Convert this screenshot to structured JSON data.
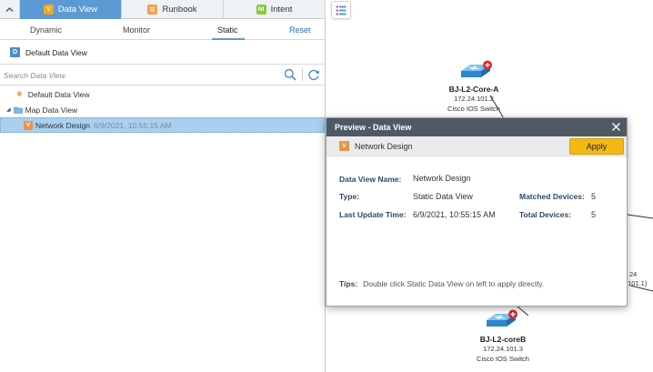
{
  "tabs": [
    {
      "label": "Data View",
      "icon_letter": "V",
      "icon_color": "#f0a91c",
      "active": true
    },
    {
      "label": "Runbook",
      "icon_letter": "",
      "icon_color": "#f0a054",
      "active": false
    },
    {
      "label": "Intent",
      "icon_letter": "NI",
      "icon_color": "#8dc63f",
      "active": false
    }
  ],
  "subtabs": {
    "dynamic": "Dynamic",
    "monitor": "Monitor",
    "static": "Static",
    "reset": "Reset"
  },
  "current_view": {
    "icon_letter": "D",
    "label": "Default Data View"
  },
  "search": {
    "placeholder": "Search Data View"
  },
  "tree": {
    "default_item": "Default Data View",
    "map_folder": "Map Data View",
    "selected_item": {
      "name": "Network Design",
      "timestamp": "6/9/2021, 10:55:15 AM"
    }
  },
  "map": {
    "nodes": [
      {
        "name": "BJ-L2-Core-A",
        "ip": "172.24.101.2",
        "type": "Cisco IOS Switch"
      },
      {
        "name": "BJ-L2-coreB",
        "ip": "172.24.101.3",
        "type": "Cisco IOS Switch"
      }
    ],
    "partial_label_1": "24",
    "partial_label_2": ".101.1)"
  },
  "preview": {
    "title": "Preview - Data View",
    "view_name": "Network Design",
    "apply_label": "Apply",
    "fields": {
      "name_label": "Data View Name:",
      "name_value": "Network Design",
      "type_label": "Type:",
      "type_value": "Static Data View",
      "update_label": "Last Update Time:",
      "update_value": "6/9/2021, 10:55:15 AM",
      "matched_label": "Matched Devices:",
      "matched_value": "5",
      "total_label": "Total Devices:",
      "total_value": "5"
    },
    "tips_label": "Tips:",
    "tips_text": "Double click Static Data View on left to apply directly."
  },
  "colors": {
    "tab_active": "#5d9ad4",
    "selected_row": "#a9d0f0",
    "dialog_title": "#4e5963",
    "apply_button": "#f2b816",
    "switch_body": "#3b9ad9",
    "badge": "#e0262c"
  }
}
